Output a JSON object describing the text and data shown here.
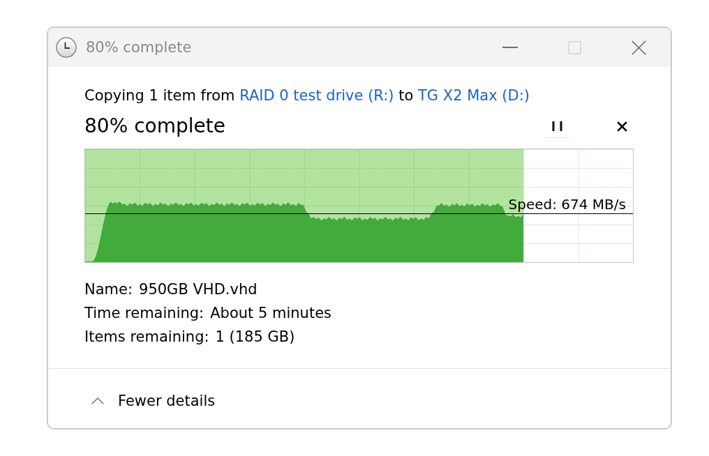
{
  "window": {
    "title": "80% complete",
    "controls": [
      {
        "kind": "minimize",
        "disabled": false
      },
      {
        "kind": "maximize",
        "disabled": true
      },
      {
        "kind": "close",
        "disabled": false
      }
    ]
  },
  "copy_summary": [
    {
      "kind": "text",
      "text": "Copying 1 item from"
    },
    {
      "kind": "link",
      "text": "RAID 0 test drive (R:)"
    },
    {
      "kind": "text",
      "text": "to"
    },
    {
      "kind": "link",
      "text": "TG X2 Max (D:)"
    }
  ],
  "progress": {
    "heading": "80% complete",
    "level": 0.8,
    "paused": false
  },
  "speed_graph": {
    "speed_label": "Speed: 674 MB/s"
  },
  "details": [
    {
      "label": "Name:",
      "value": "950GB VHD.vhd"
    },
    {
      "label": "Time remaining:",
      "value": "About 5 minutes"
    },
    {
      "label": "Items remaining:",
      "value": "1 (185 GB)"
    }
  ],
  "details_toggle": {
    "label": "Fewer details",
    "expanded": true
  }
}
